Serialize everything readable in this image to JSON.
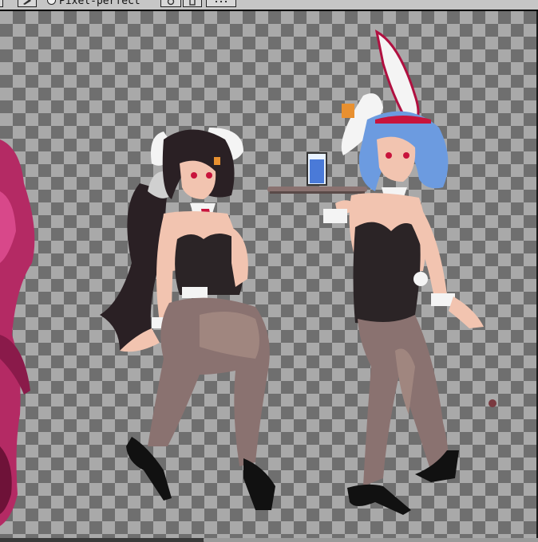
{
  "toolbar": {
    "pixel_perfect_label": "Pixel-perfect",
    "icons": [
      "brush-icon",
      "pixel-perfect-toggle",
      "option-button-1",
      "option-button-2",
      "more-options-button"
    ]
  },
  "colors": {
    "checker_dark": "#6f6f6f",
    "checker_light": "#a9a9a9",
    "toolbar_bg": "#c6c6c6",
    "skin": "#f2c4b0",
    "bunny_suit": "#2b2426",
    "tights": "#8a7270",
    "tie": "#c8143c",
    "hair_dark": "#2a2024",
    "hair_blue": "#6c9be0",
    "magenta_figure": "#b42a64"
  },
  "canvas": {
    "content": "pixel-art-sprites"
  }
}
